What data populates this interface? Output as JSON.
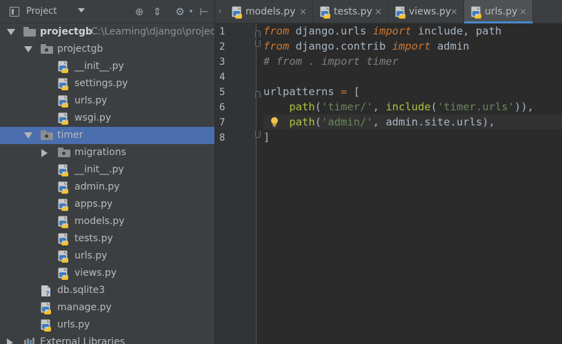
{
  "panel": {
    "title": "Project",
    "tools": [
      "target-icon",
      "collapse-icon",
      "gear-icon",
      "hide-icon"
    ]
  },
  "tree": [
    {
      "label": "projectgb",
      "path": "C:\\Learning\\django\\project",
      "type": "root-folder",
      "expanded": true
    },
    {
      "label": "projectgb",
      "type": "package-folder",
      "expanded": true
    },
    {
      "label": "__init__.py",
      "type": "python-file"
    },
    {
      "label": "settings.py",
      "type": "python-file"
    },
    {
      "label": "urls.py",
      "type": "python-file"
    },
    {
      "label": "wsgi.py",
      "type": "python-file"
    },
    {
      "label": "timer",
      "type": "package-folder",
      "expanded": true,
      "selected": true
    },
    {
      "label": "migrations",
      "type": "package-folder",
      "expanded": false
    },
    {
      "label": "__init__.py",
      "type": "python-file"
    },
    {
      "label": "admin.py",
      "type": "python-file"
    },
    {
      "label": "apps.py",
      "type": "python-file"
    },
    {
      "label": "models.py",
      "type": "python-file"
    },
    {
      "label": "tests.py",
      "type": "python-file"
    },
    {
      "label": "urls.py",
      "type": "python-file"
    },
    {
      "label": "views.py",
      "type": "python-file"
    },
    {
      "label": "db.sqlite3",
      "type": "unknown-file"
    },
    {
      "label": "manage.py",
      "type": "python-file"
    },
    {
      "label": "urls.py",
      "type": "python-file"
    },
    {
      "label": "External Libraries",
      "type": "library"
    }
  ],
  "tabs": [
    {
      "label": "models.py",
      "close": "×",
      "active": false
    },
    {
      "label": "tests.py",
      "close": "×",
      "active": false
    },
    {
      "label": "views.py",
      "close": "×",
      "active": false
    },
    {
      "label": "urls.py",
      "close": "×",
      "active": true
    }
  ],
  "tab_scroll_glyph": "‹",
  "editor": {
    "line_numbers": [
      "1",
      "2",
      "3",
      "4",
      "5",
      "6",
      "7",
      "8"
    ],
    "current_line": "7",
    "lines": [
      [
        {
          "t": "from",
          "c": "kw"
        },
        {
          "t": " django.urls ",
          "c": "txt"
        },
        {
          "t": "import",
          "c": "kw"
        },
        {
          "t": " include, path",
          "c": "txt"
        }
      ],
      [
        {
          "t": "from",
          "c": "kw"
        },
        {
          "t": " django.contrib ",
          "c": "txt"
        },
        {
          "t": "import",
          "c": "kw"
        },
        {
          "t": " admin",
          "c": "txt"
        }
      ],
      [
        {
          "t": "# from . import timer",
          "c": "cmt"
        }
      ],
      [],
      [
        {
          "t": "urlpatterns ",
          "c": "txt"
        },
        {
          "t": "=",
          "c": "kw2"
        },
        {
          "t": " [",
          "c": "txt"
        }
      ],
      [
        {
          "t": "    ",
          "c": "txt"
        },
        {
          "t": "path",
          "c": "fn"
        },
        {
          "t": "(",
          "c": "txt"
        },
        {
          "t": "'timer/'",
          "c": "str"
        },
        {
          "t": ", ",
          "c": "txt"
        },
        {
          "t": "include",
          "c": "fn"
        },
        {
          "t": "(",
          "c": "txt"
        },
        {
          "t": "'timer.urls'",
          "c": "str"
        },
        {
          "t": ")),",
          "c": "txt"
        }
      ],
      [
        {
          "t": "    ",
          "c": "txt"
        },
        {
          "t": "path",
          "c": "fn"
        },
        {
          "t": "(",
          "c": "txt"
        },
        {
          "t": "'admin/'",
          "c": "str"
        },
        {
          "t": ", admin.site.urls),",
          "c": "txt"
        }
      ],
      [
        {
          "t": "]",
          "c": "txt"
        }
      ]
    ]
  },
  "colors": {
    "panel_bg": "#3c3f41",
    "editor_bg": "#2b2b2b",
    "selection": "#4b6eaf",
    "keyword": "#cc7832",
    "string": "#6a8759",
    "function": "#b0c13f",
    "comment": "#808080"
  }
}
